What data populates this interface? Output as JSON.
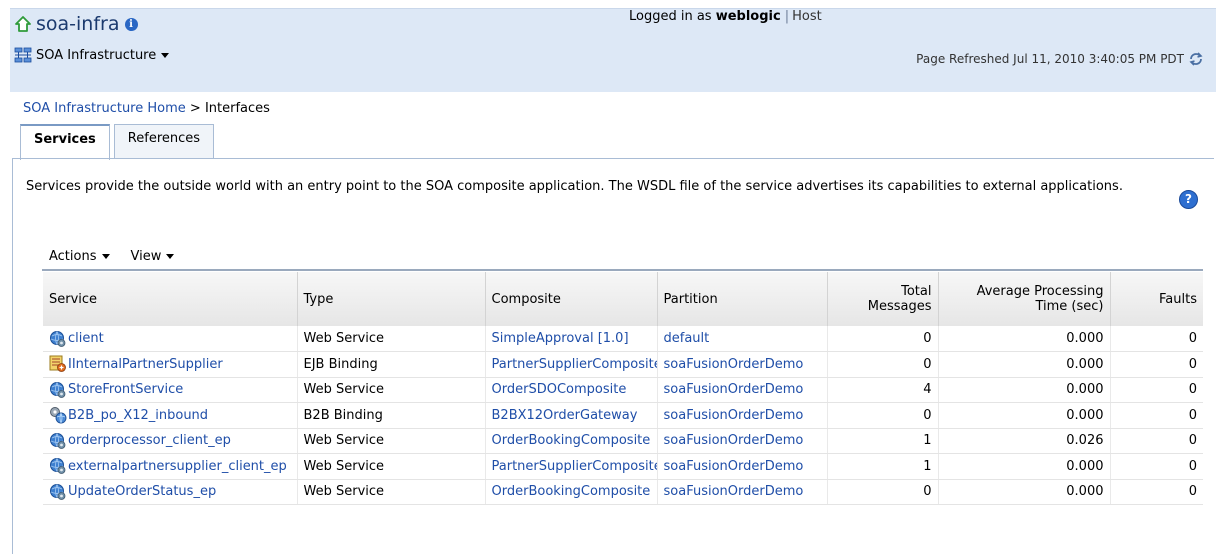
{
  "header": {
    "app_title": "soa-infra",
    "menu_label": "SOA Infrastructure",
    "logged_in_prefix": "Logged in as",
    "username": "weblogic",
    "separator": "|",
    "host_label": "Host",
    "page_refreshed": "Page Refreshed Jul 11, 2010 3:40:05 PM PDT"
  },
  "breadcrumb": {
    "home": "SOA Infrastructure Home",
    "separator": ">",
    "current": "Interfaces"
  },
  "tabs": [
    {
      "label": "Services",
      "active": true
    },
    {
      "label": "References",
      "active": false
    }
  ],
  "description": "Services provide the outside world with an entry point to the SOA composite application. The WSDL file of the service advertises its capabilities to external applications.",
  "toolbar": {
    "actions_label": "Actions",
    "view_label": "View"
  },
  "table": {
    "columns": {
      "service": "Service",
      "type": "Type",
      "composite": "Composite",
      "partition": "Partition",
      "total_messages_1": "Total",
      "total_messages_2": "Messages",
      "avg_time_1": "Average Processing",
      "avg_time_2": "Time (sec)",
      "faults": "Faults"
    },
    "rows": [
      {
        "icon": "web-service-icon",
        "service": "client",
        "type": "Web Service",
        "composite": "SimpleApproval [1.0]",
        "partition": "default",
        "total": "0",
        "avg": "0.000",
        "faults": "0"
      },
      {
        "icon": "ejb-binding-icon",
        "service": "IInternalPartnerSupplier",
        "type": "EJB Binding",
        "composite": "PartnerSupplierComposite",
        "partition": "soaFusionOrderDemo",
        "total": "0",
        "avg": "0.000",
        "faults": "0"
      },
      {
        "icon": "web-service-icon",
        "service": "StoreFrontService",
        "type": "Web Service",
        "composite": "OrderSDOComposite",
        "partition": "soaFusionOrderDemo",
        "total": "4",
        "avg": "0.000",
        "faults": "0"
      },
      {
        "icon": "b2b-binding-icon",
        "service": "B2B_po_X12_inbound",
        "type": "B2B Binding",
        "composite": "B2BX12OrderGateway",
        "partition": "soaFusionOrderDemo",
        "total": "0",
        "avg": "0.000",
        "faults": "0"
      },
      {
        "icon": "web-service-icon",
        "service": "orderprocessor_client_ep",
        "type": "Web Service",
        "composite": "OrderBookingComposite",
        "partition": "soaFusionOrderDemo",
        "total": "1",
        "avg": "0.026",
        "faults": "0"
      },
      {
        "icon": "web-service-icon",
        "service": "externalpartnersupplier_client_ep",
        "type": "Web Service",
        "composite": "PartnerSupplierComposite",
        "partition": "soaFusionOrderDemo",
        "total": "1",
        "avg": "0.000",
        "faults": "0"
      },
      {
        "icon": "web-service-icon",
        "service": "UpdateOrderStatus_ep",
        "type": "Web Service",
        "composite": "OrderBookingComposite",
        "partition": "soaFusionOrderDemo",
        "total": "0",
        "avg": "0.000",
        "faults": "0"
      }
    ]
  },
  "colors": {
    "header_bg": "#dde8f6",
    "link": "#1f4ea8",
    "tab_border": "#a9bcd5"
  }
}
